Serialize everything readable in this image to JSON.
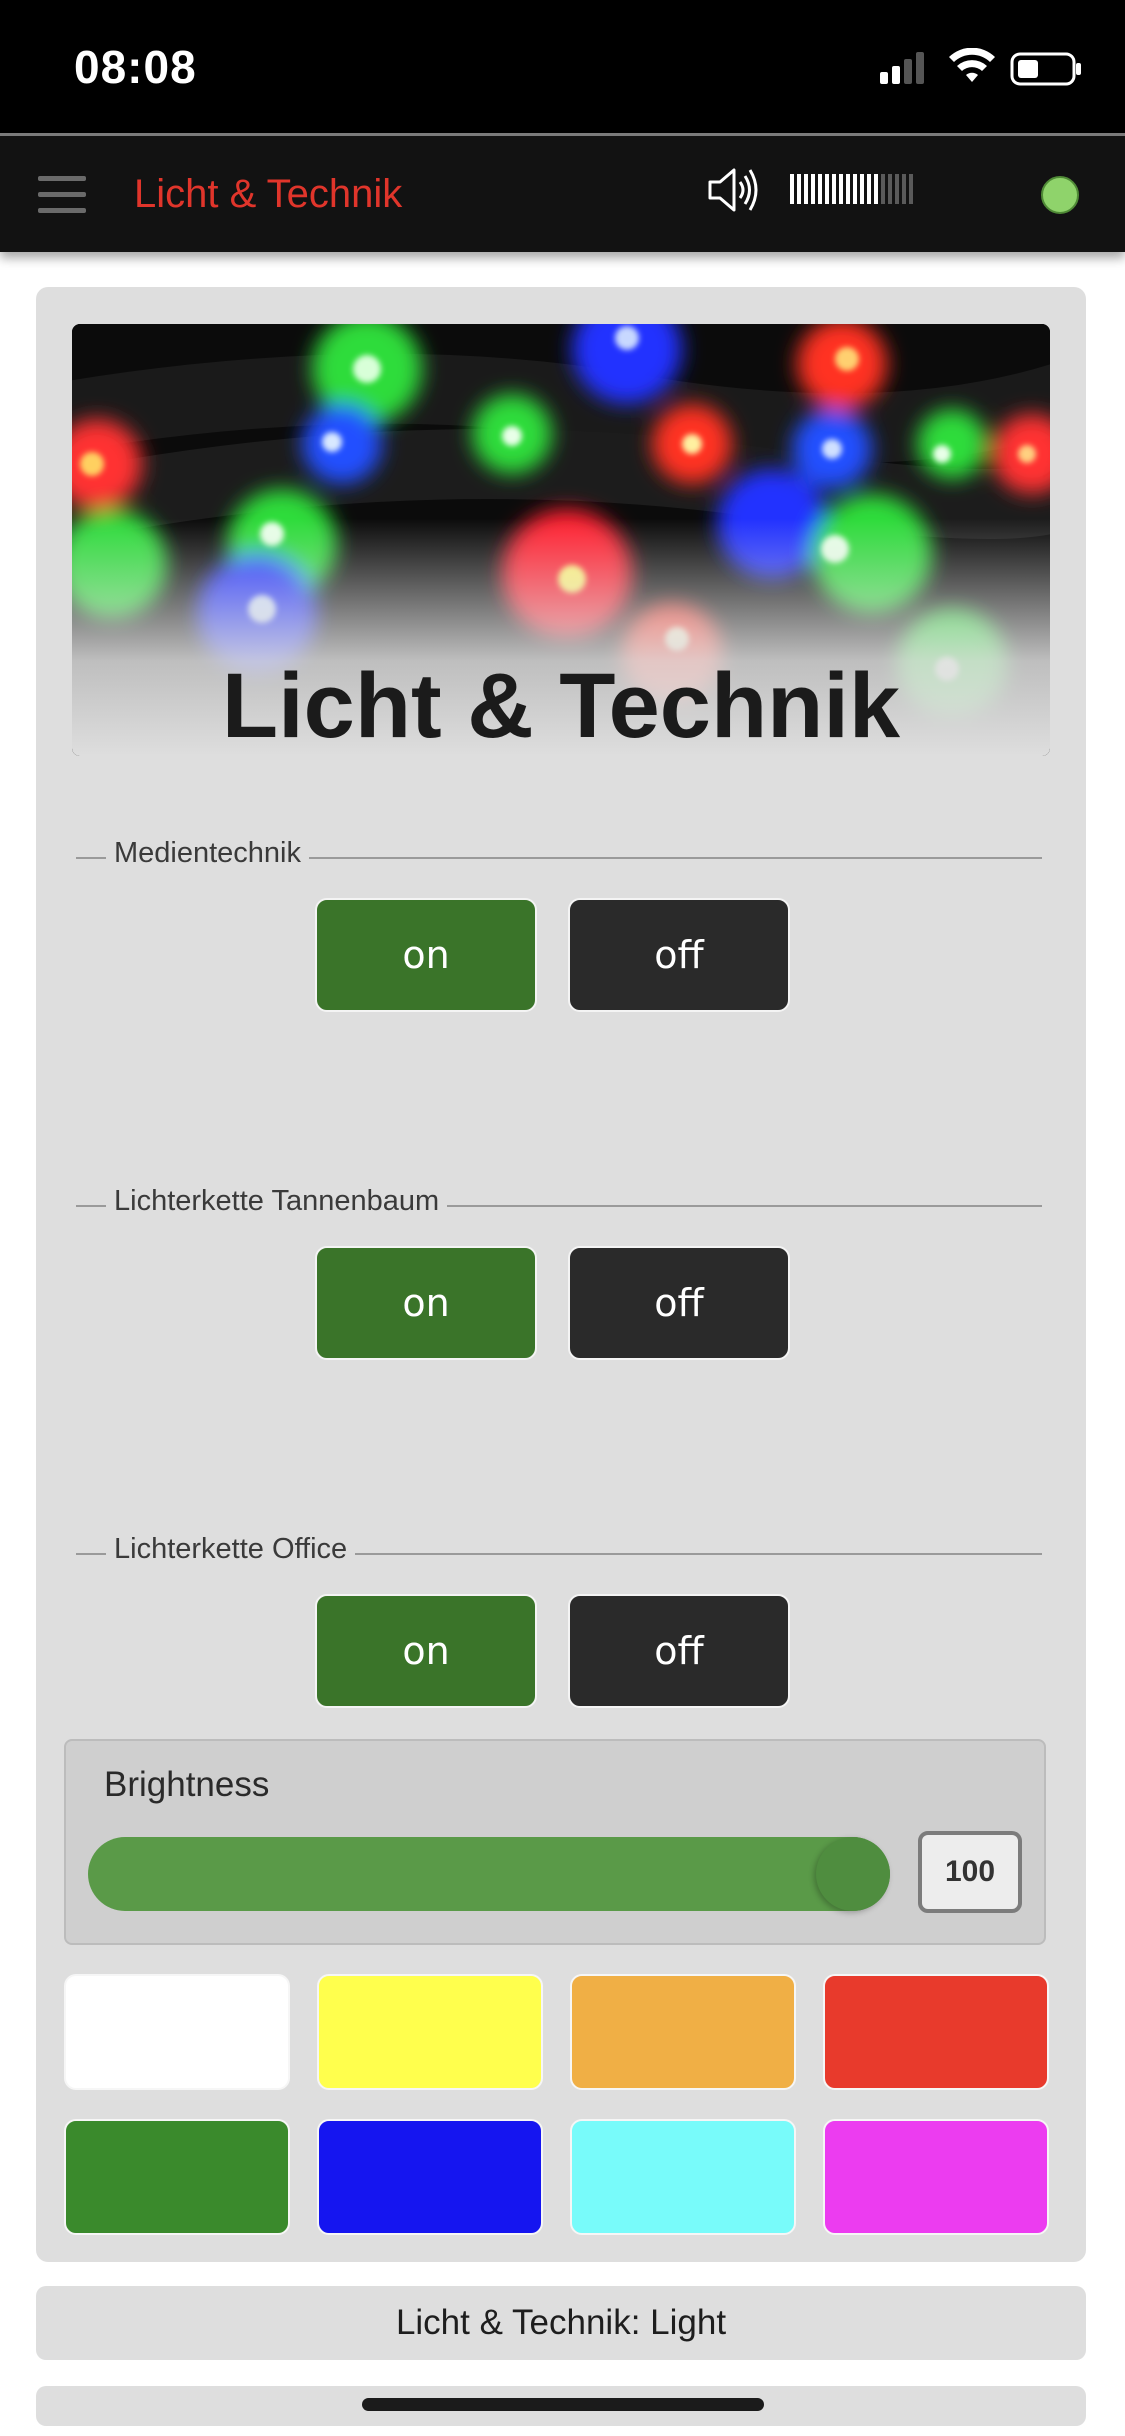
{
  "status": {
    "time": "08:08"
  },
  "appbar": {
    "title": "Licht & Technik",
    "menu_icon": "hamburger-menu-icon",
    "speaker_icon": "speaker-icon",
    "volume_level": 0.72,
    "connection_status_color": "#8fd36b"
  },
  "hero": {
    "title": "Licht & Technik"
  },
  "groups": [
    {
      "label": "Medientechnik",
      "on_label": "on",
      "off_label": "off"
    },
    {
      "label": "Lichterkette Tannenbaum",
      "on_label": "on",
      "off_label": "off"
    },
    {
      "label": "Lichterkette Office",
      "on_label": "on",
      "off_label": "off"
    }
  ],
  "brightness": {
    "label": "Brightness",
    "value": "100",
    "level": 1.0
  },
  "colors": [
    "#ffffff",
    "#ffff4d",
    "#f0af45",
    "#e83a2c",
    "#3a8a2c",
    "#1515f0",
    "#78fbfa",
    "#ec3cf0"
  ],
  "footer": {
    "text": "Licht & Technik: Light"
  },
  "theme": {
    "accent": "#e0352b",
    "on_color": "#3a7429",
    "off_color": "#2a2a2a"
  }
}
